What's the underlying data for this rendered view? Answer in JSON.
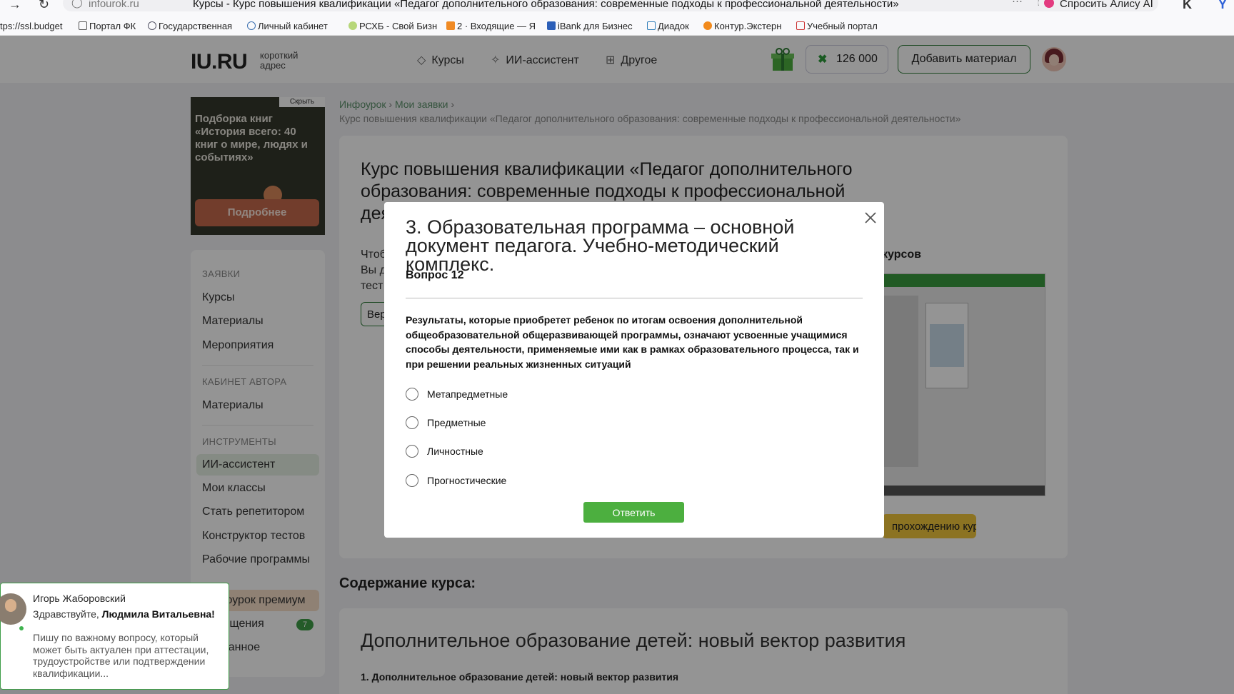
{
  "browser": {
    "url": "infourok.ru",
    "page_title": "Курсы - Курс повышения квалификации «Педагог дополнительного образования: современные подходы к профессиональной деятельности»",
    "alice_label": "Спросить Алису AI",
    "bookmarks": [
      "tps://ssl.budget",
      "Портал ФК",
      "Государственная",
      "Личный кабинет",
      "РСХБ - Свой Бизн",
      "2 · Входящие — Я",
      "iBank для Бизнес",
      "Диадок",
      "Контур.Экстерн",
      "Учебный портал"
    ]
  },
  "header": {
    "logo": "IU.RU",
    "logo_sub": "короткий адрес",
    "nav": [
      "Курсы",
      "ИИ-ассистент",
      "Другое"
    ],
    "bonus": "126 000",
    "add_material": "Добавить материал"
  },
  "promo": {
    "hide_label": "Скрыть",
    "text": "Подборка книг «История всего: 40 книг о мире, людях и событиях»",
    "button": "Подробнее"
  },
  "sidebar": {
    "section_requests": "Заявки",
    "requests": [
      "Курсы",
      "Материалы",
      "Мероприятия"
    ],
    "section_author": "Кабинет автора",
    "author": [
      "Материалы"
    ],
    "section_tools": "Инструменты",
    "tools": [
      "ИИ-ассистент",
      "Мои классы",
      "Стать репетитором",
      "Конструктор тестов",
      "Рабочие программы"
    ],
    "premium": "Инфоурок премиум",
    "messages": "Сообщения",
    "messages_count": "7",
    "favorites": "Избранное"
  },
  "breadcrumbs": {
    "items": [
      "Инфоурок",
      "Мои заявки"
    ],
    "current": "Курс повышения квалификации «Педагог дополнительного образования: современные подходы к профессиональной деятельности»"
  },
  "course": {
    "title": "Курс повышения квалификации «Педагог дополнительного образования: современные подходы к профессиональной деятельности»",
    "desc_lines": [
      "Чтобы",
      "Вы д",
      "тест"
    ],
    "ver_button": "Вер",
    "video_title": "курсов",
    "yellow_button": "прохождению курсов"
  },
  "content": {
    "heading": "Содержание курса:",
    "module_title": "Дополнительное образование детей: новый вектор развития",
    "module_sub": "1. Дополнительное образование детей: новый вектор развития"
  },
  "modal": {
    "title": "3. Образовательная программа – основной документ педагога. Учебно-методический комплекс.",
    "question_number": "Вопрос 12",
    "question_text": "Результаты, которые приобретет ребенок по итогам освоения дополнительной общеобразовательной общеразвивающей программы, означают усвоенные учащимися способы деятельности, применяемые ими как в рамках образовательного процесса, так и при решении реальных жизненных ситуаций",
    "options": [
      "Метапредметные",
      "Предметные",
      "Личностные",
      "Прогностические"
    ],
    "answer_button": "Ответить"
  },
  "chat": {
    "sender": "Игорь Жаборовский",
    "greeting_prefix": "Здравствуйте,",
    "greeting_name": "Людмила Витальевна!",
    "message": "Пишу по важному вопросу, который может быть актуален при аттестации, трудоустройстве или подтверждении квалификации..."
  }
}
